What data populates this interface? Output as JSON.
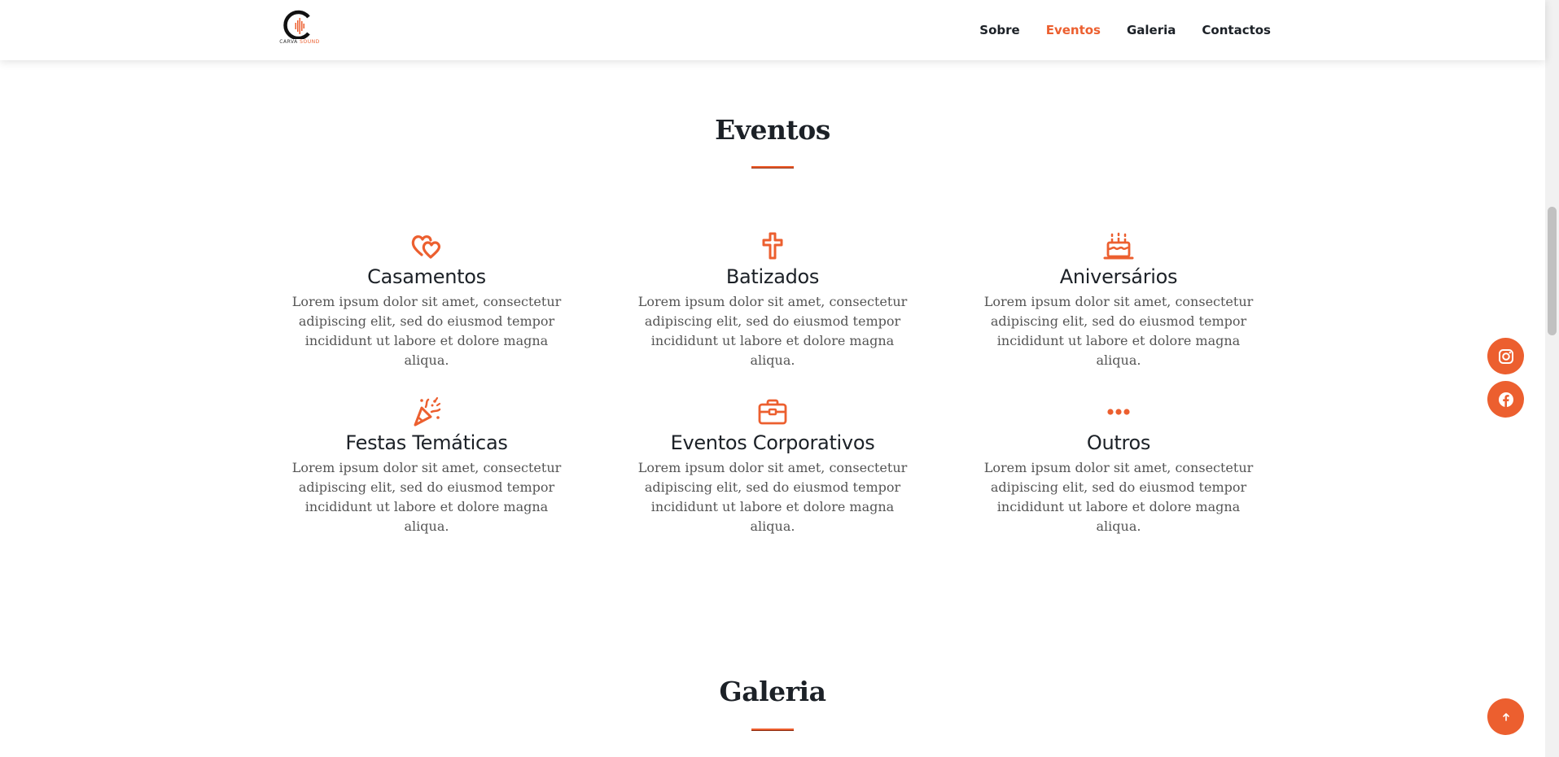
{
  "header": {
    "brand_name_part1": "CARVA",
    "brand_name_part2": "SOUND",
    "nav_items": [
      {
        "label": "Sobre",
        "active": false
      },
      {
        "label": "Eventos",
        "active": true
      },
      {
        "label": "Galeria",
        "active": false
      },
      {
        "label": "Contactos",
        "active": false
      }
    ]
  },
  "events_section": {
    "title": "Eventos",
    "cards": [
      {
        "icon": "hearts-icon",
        "title": "Casamentos",
        "text": "Lorem ipsum dolor sit amet, consectetur adipiscing elit, sed do eiusmod tempor incididunt ut labore et dolore magna aliqua."
      },
      {
        "icon": "cross-icon",
        "title": "Batizados",
        "text": "Lorem ipsum dolor sit amet, consectetur adipiscing elit, sed do eiusmod tempor incididunt ut labore et dolore magna aliqua."
      },
      {
        "icon": "birthday-cake-icon",
        "title": "Aniversários",
        "text": "Lorem ipsum dolor sit amet, consectetur adipiscing elit, sed do eiusmod tempor incididunt ut labore et dolore magna aliqua."
      },
      {
        "icon": "party-popper-icon",
        "title": "Festas Temáticas",
        "text": "Lorem ipsum dolor sit amet, consectetur adipiscing elit, sed do eiusmod tempor incididunt ut labore et dolore magna aliqua."
      },
      {
        "icon": "briefcase-icon",
        "title": "Eventos Corporativos",
        "text": "Lorem ipsum dolor sit amet, consectetur adipiscing elit, sed do eiusmod tempor incididunt ut labore et dolore magna aliqua."
      },
      {
        "icon": "more-dots-icon",
        "title": "Outros",
        "text": "Lorem ipsum dolor sit amet, consectetur adipiscing elit, sed do eiusmod tempor incididunt ut labore et dolore magna aliqua."
      }
    ]
  },
  "gallery_section": {
    "title": "Galeria"
  },
  "floating": {
    "social_icons": [
      "instagram-icon",
      "facebook-icon"
    ],
    "scroll_top_icon": "arrow-up-icon"
  },
  "colors": {
    "accent": "#ec5f2f",
    "text": "#1c2127",
    "body_text": "#555555"
  }
}
